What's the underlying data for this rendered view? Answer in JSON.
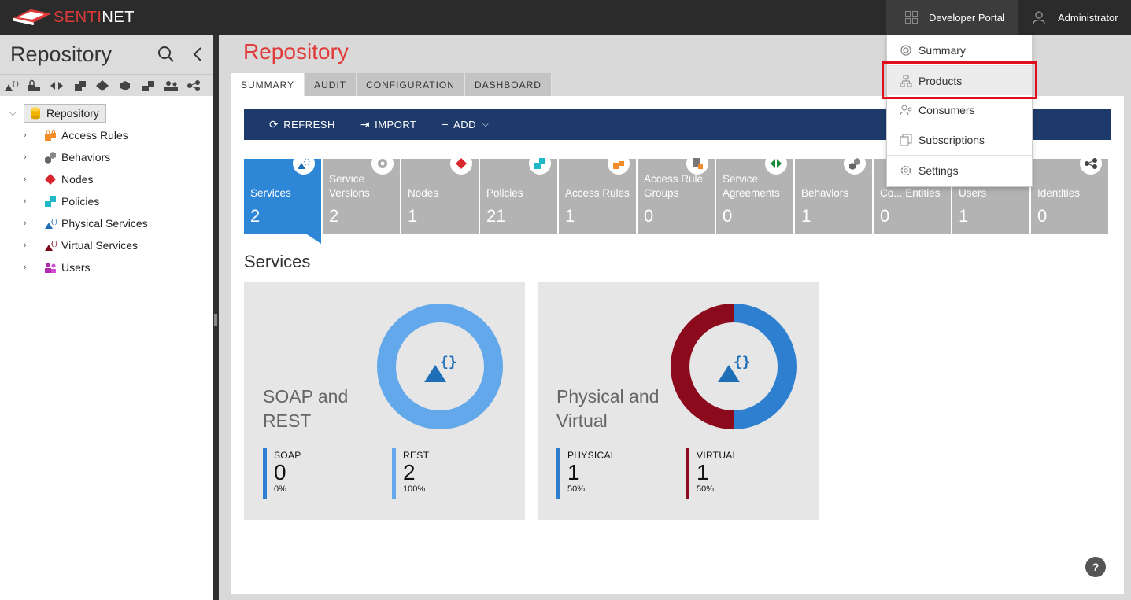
{
  "brand": {
    "name_part1": "SENTI",
    "name_part2": "NET"
  },
  "topbar": {
    "developer_portal": "Developer Portal",
    "user": "Administrator"
  },
  "sidebar": {
    "title": "Repository",
    "root": "Repository",
    "items": [
      {
        "label": "Access Rules",
        "icon": "lock-icon"
      },
      {
        "label": "Behaviors",
        "icon": "cubes-icon"
      },
      {
        "label": "Nodes",
        "icon": "node-icon"
      },
      {
        "label": "Policies",
        "icon": "policy-icon"
      },
      {
        "label": "Physical Services",
        "icon": "physical-service-icon"
      },
      {
        "label": "Virtual Services",
        "icon": "virtual-service-icon"
      },
      {
        "label": "Users",
        "icon": "users-icon"
      }
    ]
  },
  "main": {
    "title": "Repository",
    "tabs": [
      "SUMMARY",
      "AUDIT",
      "CONFIGURATION",
      "DASHBOARD"
    ],
    "toolbar": {
      "refresh": "REFRESH",
      "import": "IMPORT",
      "add": "ADD"
    },
    "tiles": [
      {
        "label": "Services",
        "value": "2",
        "icon": "service-icon",
        "active": true
      },
      {
        "label": "Service Versions",
        "value": "2",
        "icon": "gear-icon"
      },
      {
        "label": "Nodes",
        "value": "1",
        "icon": "node-icon"
      },
      {
        "label": "Policies",
        "value": "21",
        "icon": "policy-icon"
      },
      {
        "label": "Access Rules",
        "value": "1",
        "icon": "lock-icon"
      },
      {
        "label": "Access Rule Groups",
        "value": "0",
        "icon": "document-lock-icon"
      },
      {
        "label": "Service Agreements",
        "value": "0",
        "icon": "agreement-icon"
      },
      {
        "label": "Behaviors",
        "value": "1",
        "icon": "cubes-icon"
      },
      {
        "label": "Co... Entities",
        "value": "0",
        "icon": "entities-icon"
      },
      {
        "label": "Users",
        "value": "1",
        "icon": "users-icon"
      },
      {
        "label": "Identities",
        "value": "0",
        "icon": "identities-icon"
      }
    ],
    "section_title": "Services",
    "cards": [
      {
        "title": "SOAP and REST",
        "stats": [
          {
            "label": "SOAP",
            "value": "0",
            "pct": "0%",
            "color": "#2e7fd0"
          },
          {
            "label": "REST",
            "value": "2",
            "pct": "100%",
            "color": "#62a8ea"
          }
        ]
      },
      {
        "title": "Physical and Virtual",
        "stats": [
          {
            "label": "PHYSICAL",
            "value": "1",
            "pct": "50%",
            "color": "#2e7fd0"
          },
          {
            "label": "VIRTUAL",
            "value": "1",
            "pct": "50%",
            "color": "#8b0a1c"
          }
        ]
      }
    ],
    "help": "?"
  },
  "menu": {
    "items": [
      {
        "label": "Summary",
        "icon": "summary-icon"
      },
      {
        "label": "Products",
        "icon": "products-icon",
        "highlighted": true
      },
      {
        "label": "Consumers",
        "icon": "consumers-icon"
      },
      {
        "label": "Subscriptions",
        "icon": "subscriptions-icon"
      },
      {
        "label": "Settings",
        "icon": "gear-icon"
      }
    ]
  },
  "colors": {
    "accent_red": "#e03a3a",
    "toolbar_navy": "#1d3a6b",
    "tile_active": "#2e86d6",
    "tile_inactive": "#b3b3b3",
    "highlight": "#e0101a"
  }
}
